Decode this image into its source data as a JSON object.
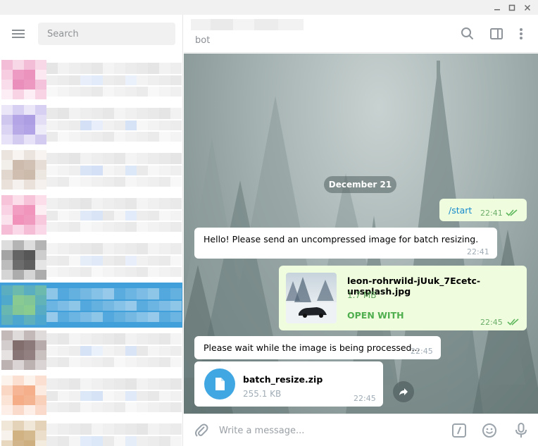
{
  "window": {
    "controls": [
      "minimize-icon",
      "maximize-icon",
      "close-icon"
    ]
  },
  "sidebar": {
    "search_placeholder": "Search",
    "chats": [
      {
        "avatar_color": "#e987b6",
        "selected": false
      },
      {
        "avatar_color": "#a999e2",
        "selected": false
      },
      {
        "avatar_color": "#c9b6a6",
        "selected": false
      },
      {
        "avatar_color": "#ef88b4",
        "selected": false
      },
      {
        "avatar_color": "#4b4b4b",
        "selected": false
      },
      {
        "avatar_color": "#8fce8a",
        "selected": true
      },
      {
        "avatar_color": "#7c6666",
        "selected": false
      },
      {
        "avatar_color": "#f4a981",
        "selected": false
      },
      {
        "avatar_color": "#caa874",
        "selected": false
      }
    ],
    "selected_color": "#419fd9"
  },
  "header": {
    "status": "bot",
    "icons": [
      "search-icon",
      "sidebar-toggle-icon",
      "more-icon"
    ]
  },
  "conversation": {
    "date": "December 21",
    "messages": [
      {
        "direction": "out",
        "text": "/start",
        "time": "22:41",
        "read": true
      },
      {
        "direction": "in",
        "text": "Hello! Please send an uncompressed image for batch resizing.",
        "time": "22:41"
      },
      {
        "direction": "out",
        "type": "file",
        "file_name": "leon-rohrwild-jUuk_7Ecetc-unsplash.jpg",
        "file_size": "1.7 MB",
        "action": "OPEN WITH",
        "time": "22:45",
        "read": true
      },
      {
        "direction": "in",
        "text": "Please wait while the image is being processed...",
        "time": "22:45"
      },
      {
        "direction": "in",
        "type": "file",
        "file_name": "batch_resize.zip",
        "file_size": "255.1 KB",
        "time": "22:45"
      }
    ]
  },
  "compose": {
    "placeholder": "Write a message...",
    "icons": [
      "attach-icon",
      "bot-command-icon",
      "emoji-icon",
      "microphone-icon"
    ]
  },
  "colors": {
    "link": "#168acd",
    "outgoing_bubble": "#effdde",
    "outgoing_accent": "#4fae4e",
    "file_icon": "#40a7e3"
  }
}
